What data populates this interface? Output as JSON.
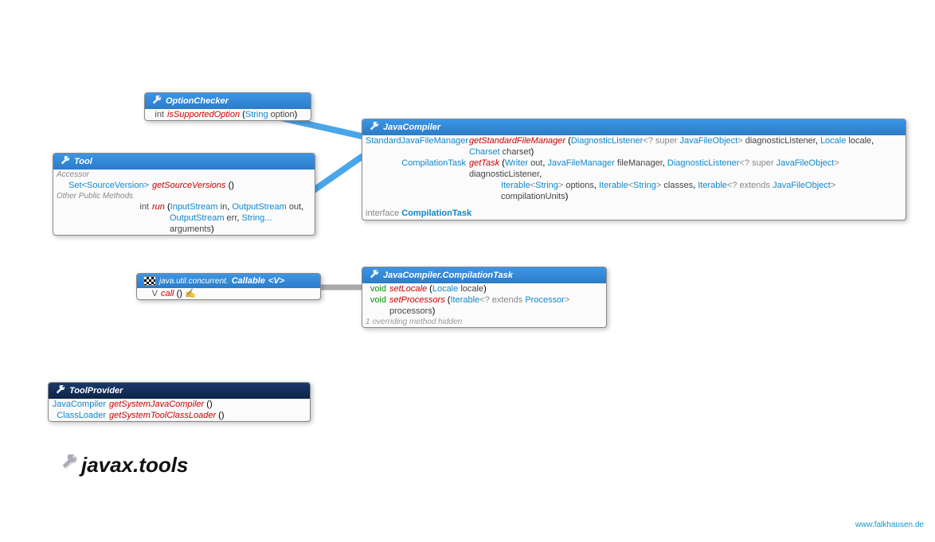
{
  "optionChecker": {
    "title": "OptionChecker",
    "m1_ret": "int",
    "m1_name": "isSupportedOption",
    "m1_p1t": "String",
    "m1_p1n": "option"
  },
  "tool": {
    "title": "Tool",
    "accessor": "Accessor",
    "m1_ret": "Set<SourceVersion>",
    "m1_name": "getSourceVersions",
    "other": "Other Public Methods",
    "m2_ret": "int",
    "m2_name": "run",
    "m2_p1t": "InputStream",
    "m2_p1n": "in",
    "m2_p2t": "OutputStream",
    "m2_p2n": "out",
    "m2_p3t": "OutputStream",
    "m2_p3n": "err",
    "m2_p4t": "String...",
    "m2_p4n": "arguments"
  },
  "javaCompiler": {
    "title": "JavaCompiler",
    "m1_ret": "StandardJavaFileManager",
    "m1_name": "getStandardFileManager",
    "m1_p1a": "DiagnosticListener",
    "m1_p1b": "<? super ",
    "m1_p1c": "JavaFileObject",
    "m1_p1d": ">",
    "m1_p1n": "diagnosticListener",
    "m1_p2t": "Locale",
    "m1_p2n": "locale",
    "m1_p3t": "Charset",
    "m1_p3n": "charset",
    "m2_ret": "CompilationTask",
    "m2_name": "getTask",
    "m2_p1t": "Writer",
    "m2_p1n": "out",
    "m2_p2t": "JavaFileManager",
    "m2_p2n": "fileManager",
    "m2_p3a": "DiagnosticListener",
    "m2_p3b": "<? super ",
    "m2_p3c": "JavaFileObject",
    "m2_p3d": ">",
    "m2_p3n": "diagnosticListener",
    "m2_l2_p1a": "Iterable",
    "m2_l2_p1b": "<",
    "m2_l2_p1c": "String",
    "m2_l2_p1d": ">",
    "m2_l2_p1n": "options",
    "m2_l2_p2a": "Iterable",
    "m2_l2_p2b": "<",
    "m2_l2_p2c": "String",
    "m2_l2_p2d": ">",
    "m2_l2_p2n": "classes",
    "m2_l2_p3a": "Iterable",
    "m2_l2_p3b": "<? extends ",
    "m2_l2_p3c": "JavaFileObject",
    "m2_l2_p3d": ">",
    "m2_l2_p3n": "compilationUnits",
    "iface_kw": "interface",
    "iface_name": "CompilationTask"
  },
  "callable": {
    "pkg": "java.util.concurrent.",
    "title": "Callable",
    "tparams": "<V>",
    "m1_ret": "V",
    "m1_name": "call",
    "m1_throws": "✍"
  },
  "compilationTask": {
    "title": "JavaCompiler.CompilationTask",
    "m1_ret": "void",
    "m1_name": "setLocale",
    "m1_p1t": "Locale",
    "m1_p1n": "locale",
    "m2_ret": "void",
    "m2_name": "setProcessors",
    "m2_p1a": "Iterable",
    "m2_p1b": "<? extends ",
    "m2_p1c": "Processor",
    "m2_p1d": ">",
    "m2_p1n": "processors",
    "hidden": "1 overriding method hidden"
  },
  "toolProvider": {
    "title": "ToolProvider",
    "m1_ret": "JavaCompiler",
    "m1_name": "getSystemJavaCompiler",
    "m2_ret": "ClassLoader",
    "m2_name": "getSystemToolClassLoader"
  },
  "caption": "javax.tools",
  "footer": "www.falkhausen.de"
}
